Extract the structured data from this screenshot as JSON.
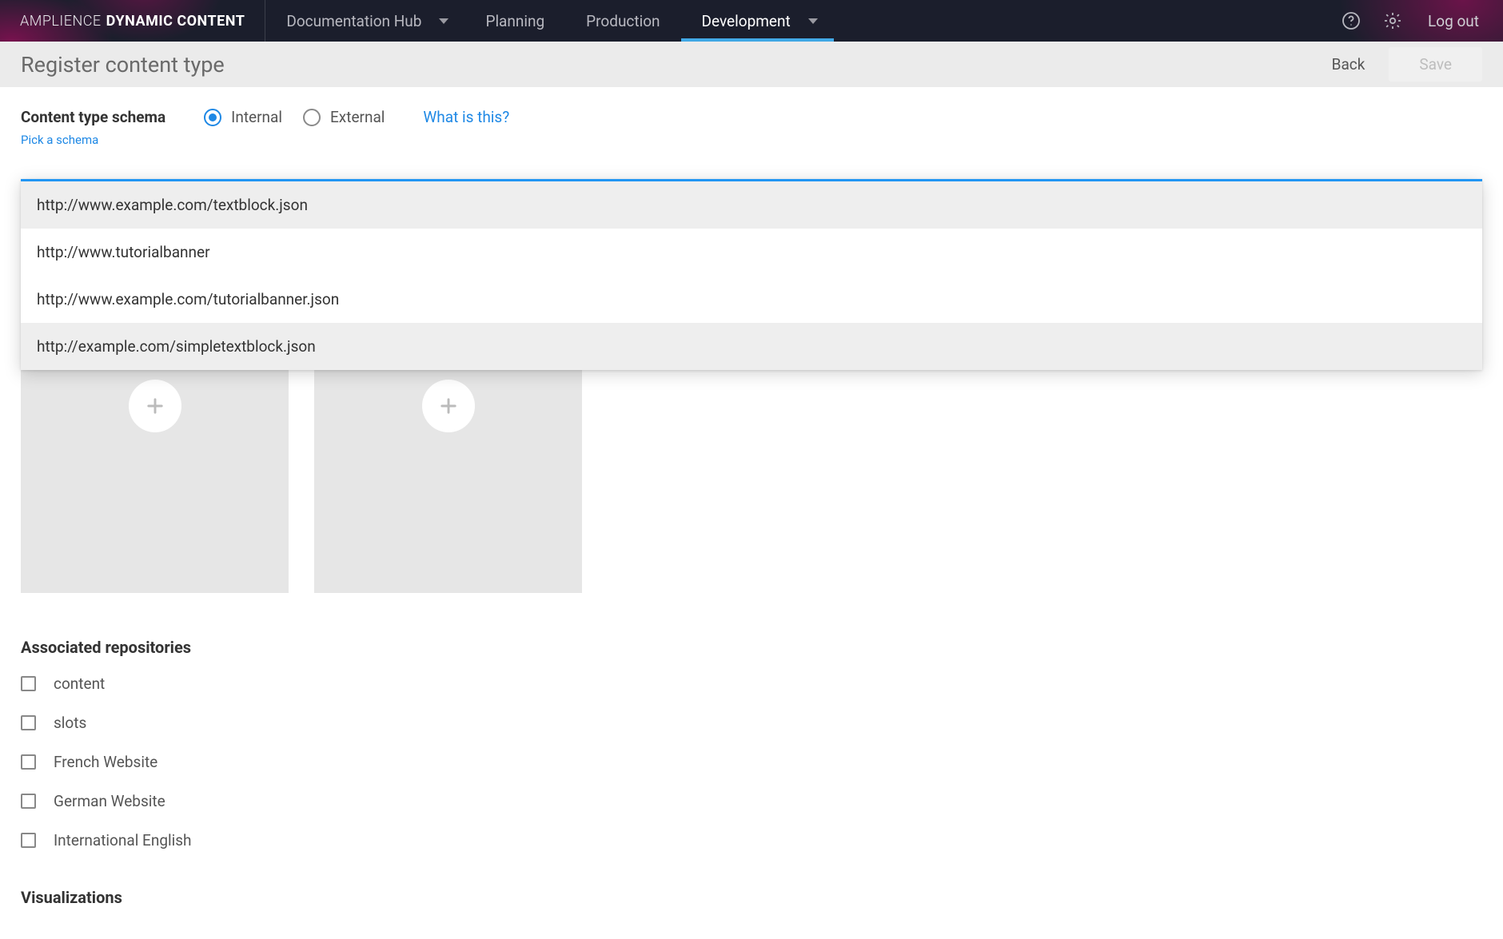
{
  "brand": {
    "light": "AMPLIENCE",
    "bold": "DYNAMIC CONTENT"
  },
  "nav": {
    "hub": "Documentation Hub",
    "planning": "Planning",
    "production": "Production",
    "development": "Development",
    "logout": "Log out"
  },
  "page": {
    "title": "Register content type",
    "back": "Back",
    "save": "Save"
  },
  "schema": {
    "label": "Content type schema",
    "internal": "Internal",
    "external": "External",
    "what": "What is this?",
    "pick": "Pick a schema"
  },
  "dropdown": {
    "items": [
      "http://www.example.com/textblock.json",
      "http://www.tutorialbanner",
      "http://www.example.com/tutorialbanner.json",
      "http://example.com/simpletextblock.json"
    ]
  },
  "repos": {
    "heading": "Associated repositories",
    "items": [
      "content",
      "slots",
      "French Website",
      "German Website",
      "International English"
    ]
  },
  "viz": {
    "heading": "Visualizations"
  }
}
